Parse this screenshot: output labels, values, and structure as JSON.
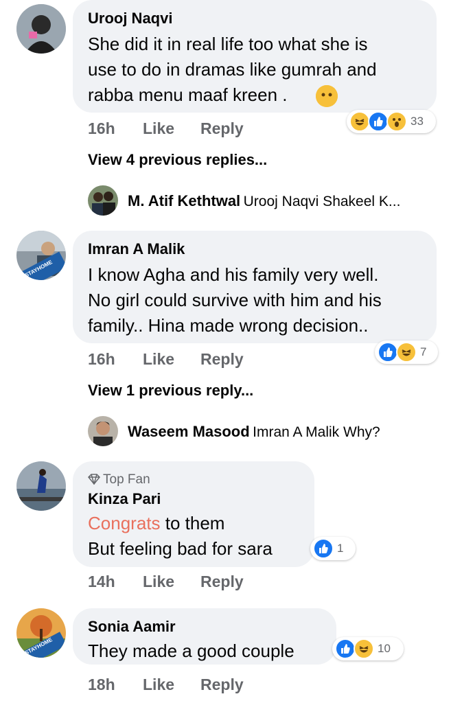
{
  "comments": [
    {
      "author": "Urooj Naqvi",
      "lines": [
        "She did it in real life too what she is",
        "use to do in dramas like gumrah and",
        "rabba menu maaf kreen ."
      ],
      "time": "16h",
      "like": "Like",
      "reply": "Reply",
      "reaction_count": "33",
      "view_more": "View 4 previous replies...",
      "reply_preview": {
        "author": "M. Atif Kethtwal",
        "text": "Urooj Naqvi Shakeel K..."
      }
    },
    {
      "author": "Imran A Malik",
      "lines": [
        "I know Agha and his family very well.",
        "No girl could survive with him and his",
        "family.. Hina made wrong decision.."
      ],
      "time": "16h",
      "like": "Like",
      "reply": "Reply",
      "reaction_count": "7",
      "view_more": "View 1 previous reply...",
      "reply_preview": {
        "author": "Waseem Masood",
        "text": "Imran A Malik Why?"
      },
      "avatar_badge": "#STAYHOME"
    },
    {
      "badge": "Top Fan",
      "author": "Kinza Pari",
      "line1_highlight": "Congrats",
      "line1_rest": " to them",
      "line2": "But feeling bad for sara",
      "time": "14h",
      "like": "Like",
      "reply": "Reply",
      "reaction_count": "1"
    },
    {
      "author": "Sonia Aamir",
      "lines": [
        "They made a good couple"
      ],
      "time": "18h",
      "like": "Like",
      "reply": "Reply",
      "reaction_count": "10",
      "avatar_badge": "#STAYHOME"
    }
  ],
  "colors": {
    "bubble": "#f0f2f5",
    "meta": "#65676b",
    "like_blue": "#1877f2",
    "emoji_yellow": "#f7c03a",
    "congrats": "#e9705d"
  }
}
